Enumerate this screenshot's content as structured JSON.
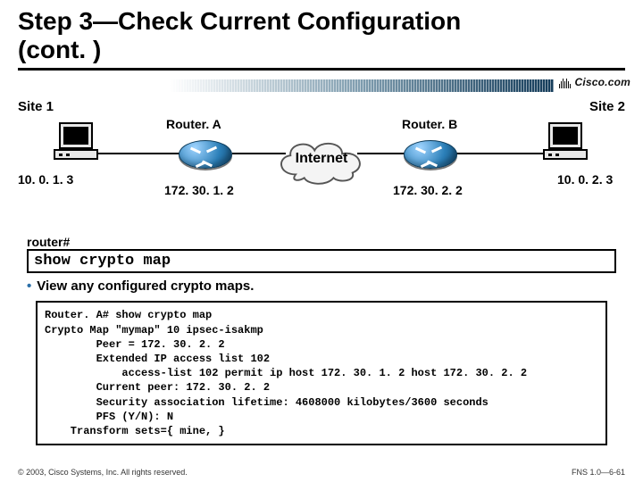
{
  "title_line1": "Step 3—Check Current Configuration",
  "title_line2": "(cont. )",
  "brand": "Cisco.com",
  "diagram": {
    "site1": "Site 1",
    "site2": "Site 2",
    "routerA": "Router. A",
    "routerB": "Router. B",
    "internet": "Internet",
    "ip_left_pc": "10. 0. 1. 3",
    "ip_right_pc": "10. 0. 2. 3",
    "ip_routerA_wan": "172. 30. 1. 2",
    "ip_routerB_wan": "172. 30. 2. 2"
  },
  "prompt": "router#",
  "command": "show crypto map",
  "bullet": "View any configured crypto maps.",
  "output": "Router. A# show crypto map\nCrypto Map \"mymap\" 10 ipsec-isakmp\n        Peer = 172. 30. 2. 2\n        Extended IP access list 102\n            access-list 102 permit ip host 172. 30. 1. 2 host 172. 30. 2. 2\n        Current peer: 172. 30. 2. 2\n        Security association lifetime: 4608000 kilobytes/3600 seconds\n        PFS (Y/N): N\n    Transform sets={ mine, }",
  "footer_left": "© 2003, Cisco Systems, Inc. All rights reserved.",
  "footer_right": "FNS 1.0—6-61"
}
